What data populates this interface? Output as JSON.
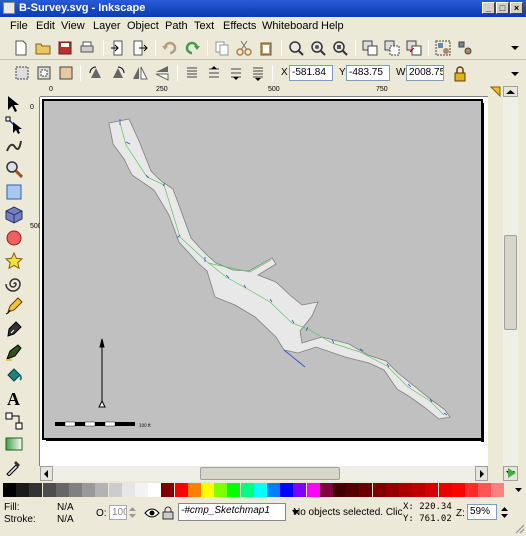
{
  "window": {
    "title": "B-Survey.svg - Inkscape",
    "btn_min": "_",
    "btn_max": "□",
    "btn_close": "×"
  },
  "menu": [
    "File",
    "Edit",
    "View",
    "Layer",
    "Object",
    "Path",
    "Text",
    "Effects",
    "Whiteboard",
    "Help"
  ],
  "command_icons": [
    "new-icon",
    "open-icon",
    "save-icon",
    "print-icon",
    "import-icon",
    "export-icon",
    "undo-icon",
    "redo-icon",
    "copy-icon",
    "cut-icon",
    "paste-icon",
    "zoom-selection-icon",
    "zoom-drawing-icon",
    "zoom-page-icon",
    "duplicate-icon",
    "clone-icon",
    "unlink-clone-icon",
    "group-icon",
    "ungroup-icon"
  ],
  "context": {
    "x_label": "X",
    "x_value": "-581.84",
    "y_label": "Y",
    "y_value": "-483.75",
    "w_label": "W",
    "w_value": "2008.75"
  },
  "tools": [
    "selector-tool-icon",
    "node-tool-icon",
    "tweak-tool-icon",
    "zoom-tool-icon",
    "rectangle-tool-icon",
    "3d-box-tool-icon",
    "ellipse-tool-icon",
    "star-tool-icon",
    "spiral-tool-icon",
    "pencil-tool-icon",
    "pen-tool-icon",
    "calligraphy-tool-icon",
    "paint-bucket-tool-icon",
    "text-tool-icon",
    "connector-tool-icon",
    "gradient-tool-icon",
    "dropper-tool-icon"
  ],
  "rulers": {
    "h_ticks": [
      "0",
      "250",
      "500",
      "750"
    ],
    "v_ticks": [
      "0",
      "500"
    ]
  },
  "drawing": {
    "scale_label": "100 ft"
  },
  "palette": [
    "#000000",
    "#1a1a1a",
    "#333333",
    "#4d4d4d",
    "#666666",
    "#808080",
    "#999999",
    "#b3b3b3",
    "#cccccc",
    "#e6e6e6",
    "#f2f2f2",
    "#ffffff",
    "#800000",
    "#ff0000",
    "#ff8000",
    "#ffff00",
    "#80ff00",
    "#00ff00",
    "#00ff80",
    "#00ffff",
    "#0080ff",
    "#0000ff",
    "#8000ff",
    "#ff00ff",
    "#800040",
    "#400000",
    "#550000",
    "#6a0000",
    "#800000",
    "#950000",
    "#aa0000",
    "#bf0000",
    "#d40000",
    "#e90000",
    "#ff0000",
    "#ff2a2a",
    "#ff5555",
    "#ff8080"
  ],
  "status": {
    "fill_label": "Fill:",
    "fill_value": "N/A",
    "stroke_label": "Stroke:",
    "stroke_value": "N/A",
    "opacity_label": "O:",
    "opacity_value": "100",
    "layer": "-#cmp_Sketchmap1",
    "message": "No objects selected. Click, Sh",
    "x_coord": "X: 220.34",
    "y_coord": "Y: 761.02",
    "zoom_label": "Z:",
    "zoom_value": "59%"
  }
}
